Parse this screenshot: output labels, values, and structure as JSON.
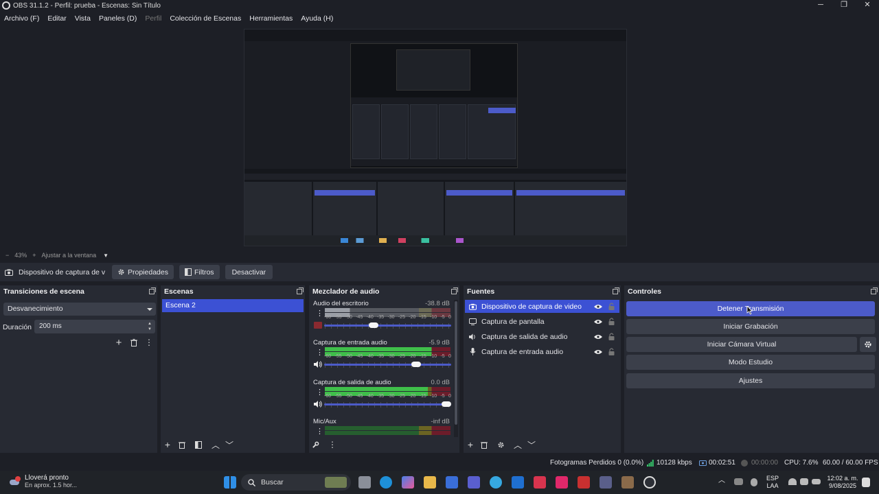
{
  "window": {
    "title": "OBS 31.1.2 - Perfil: prueba - Escenas: Sin Título",
    "controls": [
      "─",
      "❐",
      "✕"
    ]
  },
  "menu": [
    {
      "label": "Archivo (F)",
      "disabled": false
    },
    {
      "label": "Editar",
      "disabled": false
    },
    {
      "label": "Vista",
      "disabled": false
    },
    {
      "label": "Paneles (D)",
      "disabled": false
    },
    {
      "label": "Perfil",
      "disabled": true
    },
    {
      "label": "Colección de Escenas",
      "disabled": false
    },
    {
      "label": "Herramientas",
      "disabled": false
    },
    {
      "label": "Ayuda (H)",
      "disabled": false
    }
  ],
  "zoombar": {
    "minus": "−",
    "zoom": "43%",
    "plus": "+",
    "fit_label": "Ajustar a la ventana"
  },
  "source_toolbar": {
    "source_name": "Dispositivo de captura de v",
    "properties_label": "Propiedades",
    "filters_label": "Filtros",
    "deactivate_label": "Desactivar"
  },
  "transitions": {
    "title": "Transiciones de escena",
    "selected": "Desvanecimiento",
    "duration_label": "Duración",
    "duration_value": "200 ms"
  },
  "scenes": {
    "title": "Escenas",
    "items": [
      "Escena 2"
    ]
  },
  "mixer": {
    "title": "Mezclador de audio",
    "scale": [
      "-60",
      "-55",
      "-50",
      "-45",
      "-40",
      "-35",
      "-30",
      "-25",
      "-20",
      "-15",
      "-10",
      "-5",
      "0"
    ],
    "channels": [
      {
        "name": "Audio del escritorio",
        "db": "-38.8 dB",
        "level": 0.12,
        "volume": 0.38
      },
      {
        "name": "Captura de entrada audio",
        "db": "-5.9 dB",
        "level": 0.85,
        "volume": 0.74
      },
      {
        "name": "Captura de salida de audio",
        "db": "0.0 dB",
        "level": 0.82,
        "volume": 1.0
      },
      {
        "name": "Mic/Aux",
        "db": "-inf dB",
        "level": 0.0,
        "volume": 1.0
      }
    ]
  },
  "sources": {
    "title": "Fuentes",
    "items": [
      {
        "name": "Dispositivo de captura de video",
        "icon": "camera-icon",
        "selected": true
      },
      {
        "name": "Captura de pantalla",
        "icon": "monitor-icon",
        "selected": false
      },
      {
        "name": "Captura de salida de audio",
        "icon": "speaker-icon",
        "selected": false
      },
      {
        "name": "Captura de entrada audio",
        "icon": "microphone-icon",
        "selected": false
      }
    ]
  },
  "controls": {
    "title": "Controles",
    "stop_stream": "Detener Transmisión",
    "start_recording": "Iniciar Grabación",
    "start_virtual_cam": "Iniciar Cámara Virtual",
    "studio_mode": "Modo Estudio",
    "settings": "Ajustes"
  },
  "status": {
    "dropped_frames": "Fotogramas Perdidos 0 (0.0%)",
    "bitrate": "10128 kbps",
    "stream_time": "00:02:51",
    "rec_time": "00:00:00",
    "cpu": "CPU: 7.6%",
    "fps": "60.00 / 60.00 FPS"
  },
  "taskbar": {
    "weather_title": "Lloverá pronto",
    "weather_sub": "En aprox. 1.5 hor...",
    "search_placeholder": "Buscar",
    "lang_top": "ESP",
    "lang_bottom": "LAA",
    "time": "12:02 a. m.",
    "date": "9/08/2025"
  },
  "colors": {
    "accent": "#4c5bc9",
    "selected": "#3c51d4",
    "panel": "#272a33",
    "background": "#1d1f26"
  }
}
